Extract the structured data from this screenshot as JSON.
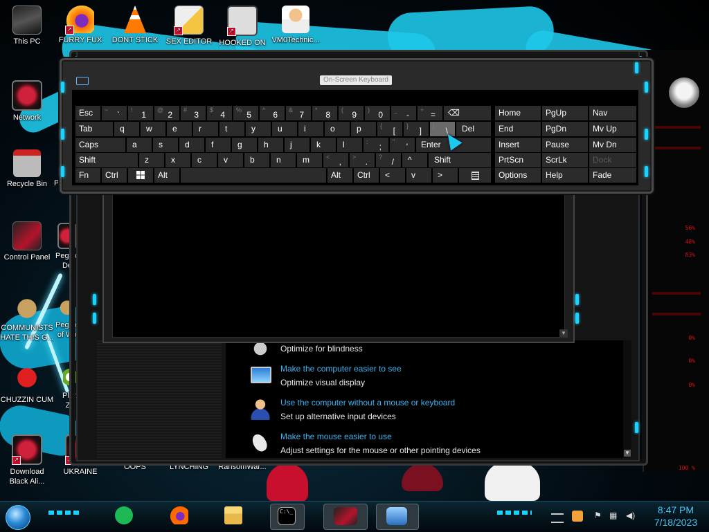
{
  "desktop": {
    "icons": [
      {
        "label": "This PC"
      },
      {
        "label": "FURRY FUX"
      },
      {
        "label": "DONT STICK"
      },
      {
        "label": "SEX EDITOR"
      },
      {
        "label": "HOOKED ON"
      },
      {
        "label": "VM0Technic..."
      },
      {
        "label": "Network"
      },
      {
        "label": "Recycle Bin"
      },
      {
        "label": "Control Panel"
      },
      {
        "label": "COMMUNISTS HATE THIS G..."
      },
      {
        "label": "CHUZZIN CUM"
      },
      {
        "label": "Download Black Ali..."
      },
      {
        "label": "UKRAINE"
      },
      {
        "label": "OOPS"
      },
      {
        "label": "LYNCHING"
      },
      {
        "label": "RansomWar..."
      }
    ],
    "partial_icons": [
      "Peggi",
      "Peggle De",
      "Peggle of Wa",
      "Plan Zo"
    ]
  },
  "osk": {
    "title": "On-Screen Keyboard",
    "rows": [
      [
        {
          "label": "Esc"
        },
        {
          "sub": "~",
          "main": "`"
        },
        {
          "sub": "!",
          "main": "1"
        },
        {
          "sub": "@",
          "main": "2"
        },
        {
          "sub": "#",
          "main": "3"
        },
        {
          "sub": "$",
          "main": "4"
        },
        {
          "sub": "%",
          "main": "5"
        },
        {
          "sub": "^",
          "main": "6"
        },
        {
          "sub": "&",
          "main": "7"
        },
        {
          "sub": "*",
          "main": "8"
        },
        {
          "sub": "(",
          "main": "9"
        },
        {
          "sub": ")",
          "main": "0"
        },
        {
          "sub": "_",
          "main": "-"
        },
        {
          "sub": "+",
          "main": "="
        },
        {
          "label": "⌫"
        }
      ],
      [
        {
          "label": "Tab"
        },
        {
          "label": "q"
        },
        {
          "label": "w"
        },
        {
          "label": "e"
        },
        {
          "label": "r"
        },
        {
          "label": "t"
        },
        {
          "label": "y"
        },
        {
          "label": "u"
        },
        {
          "label": "i"
        },
        {
          "label": "o"
        },
        {
          "label": "p"
        },
        {
          "sub": "{",
          "main": "["
        },
        {
          "sub": "}",
          "main": "]"
        },
        {
          "sub": "|",
          "main": "\\"
        },
        {
          "label": "Del"
        }
      ],
      [
        {
          "label": "Caps"
        },
        {
          "label": "a"
        },
        {
          "label": "s"
        },
        {
          "label": "d"
        },
        {
          "label": "f"
        },
        {
          "label": "g"
        },
        {
          "label": "h"
        },
        {
          "label": "j"
        },
        {
          "label": "k"
        },
        {
          "label": "l"
        },
        {
          "sub": ":",
          "main": ";"
        },
        {
          "sub": "\"",
          "main": "'"
        },
        {
          "label": "Enter"
        }
      ],
      [
        {
          "label": "Shift"
        },
        {
          "label": "z"
        },
        {
          "label": "x"
        },
        {
          "label": "c"
        },
        {
          "label": "v"
        },
        {
          "label": "b"
        },
        {
          "label": "n"
        },
        {
          "label": "m"
        },
        {
          "sub": "<",
          "main": ","
        },
        {
          "sub": ">",
          "main": "."
        },
        {
          "sub": "?",
          "main": "/"
        },
        {
          "label": "^"
        },
        {
          "label": "Shift"
        }
      ],
      [
        {
          "label": "Fn"
        },
        {
          "label": "Ctrl"
        },
        {
          "label": "win"
        },
        {
          "label": "Alt"
        },
        {
          "label": ""
        },
        {
          "label": "Alt"
        },
        {
          "label": "Ctrl"
        },
        {
          "label": "<"
        },
        {
          "label": "v"
        },
        {
          "label": ">"
        },
        {
          "label": "menu"
        }
      ]
    ],
    "nav_keys": [
      [
        "Home",
        "PgUp",
        "Nav"
      ],
      [
        "End",
        "PgDn",
        "Mv Up"
      ],
      [
        "Insert",
        "Pause",
        "Mv Dn"
      ],
      [
        "PrtScn",
        "ScrLk",
        "Dock"
      ],
      [
        "Options",
        "Help",
        "Fade"
      ]
    ]
  },
  "control_panel": {
    "options": [
      {
        "title": "",
        "desc": "Optimize for blindness",
        "icon": "blindness-icon"
      },
      {
        "title": "Make the computer easier to see",
        "desc": "Optimize visual display",
        "icon": "display-icon"
      },
      {
        "title": "Use the computer without a mouse or keyboard",
        "desc": "Set up alternative input devices",
        "icon": "person-icon"
      },
      {
        "title": "Make the mouse easier to use",
        "desc": "Adjust settings for the mouse or other pointing devices",
        "icon": "mouse-icon"
      }
    ],
    "accent": "#3fb3f0"
  },
  "widget": {
    "stats": [
      "56%",
      "48%",
      "83%",
      "0%",
      "0%",
      "0%",
      "100 %"
    ]
  },
  "taskbar": {
    "items": [
      "spotify-icon",
      "firefox-icon",
      "file-explorer-icon",
      "cmd-icon",
      "alienware-icon",
      "control-panel-icon"
    ],
    "tray": [
      "notification-icon",
      "flag-icon",
      "network-icon",
      "volume-icon"
    ],
    "time": "8:47 PM",
    "date": "7/18/2023"
  }
}
